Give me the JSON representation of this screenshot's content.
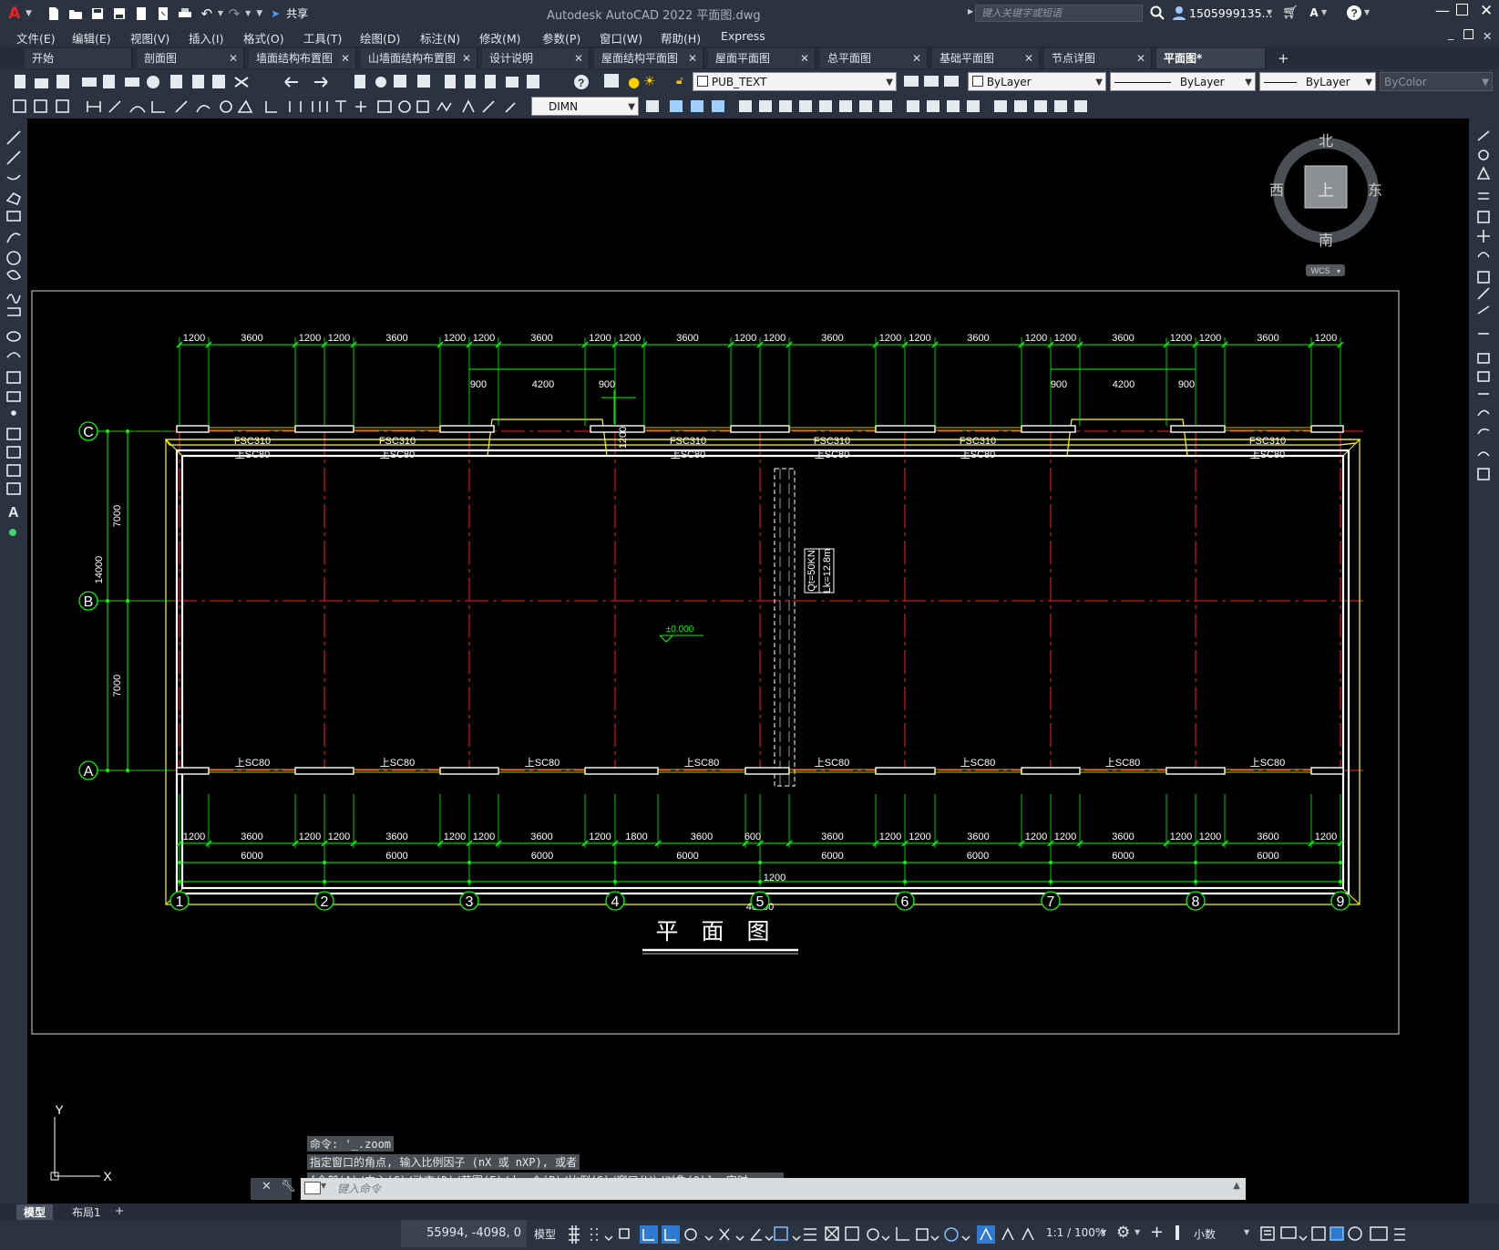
{
  "app": {
    "title": "Autodesk AutoCAD 2022    平面图.dwg",
    "share_label": "共享",
    "search_placeholder": "键入关键字或短语",
    "user": "1505999135...",
    "logo_letter": "A"
  },
  "menu": [
    "文件(E)",
    "编辑(E)",
    "视图(V)",
    "插入(I)",
    "格式(O)",
    "工具(T)",
    "绘图(D)",
    "标注(N)",
    "修改(M)",
    "参数(P)",
    "窗口(W)",
    "帮助(H)",
    "Express"
  ],
  "tabs": [
    {
      "label": "开始",
      "closable": false
    },
    {
      "label": "剖面图",
      "closable": true
    },
    {
      "label": "墙面结构布置图",
      "closable": true
    },
    {
      "label": "山墙面结构布置图",
      "closable": true
    },
    {
      "label": "设计说明",
      "closable": true
    },
    {
      "label": "屋面结构平面图",
      "closable": true
    },
    {
      "label": "屋面平面图",
      "closable": true
    },
    {
      "label": "总平面图",
      "closable": true
    },
    {
      "label": "基础平面图",
      "closable": true
    },
    {
      "label": "节点详图",
      "closable": true
    },
    {
      "label": "平面图*",
      "closable": false,
      "active": true
    }
  ],
  "properties": {
    "layer": "PUB_TEXT",
    "color": "ByLayer",
    "linetype": "ByLayer",
    "lineweight": "ByLayer",
    "plotstyle": "ByColor",
    "dimstyle": "DIMN"
  },
  "viewcube": {
    "north": "北",
    "south": "南",
    "east": "东",
    "west": "西",
    "top": "上",
    "wcs": "WCS"
  },
  "ucs": {
    "x": "X",
    "y": "Y"
  },
  "drawing": {
    "title": "平　面　图",
    "elevation": "±0.000",
    "crane_q": "Qt=50KN",
    "crane_l": "Lk=12.8m",
    "row_axes": [
      "C",
      "B",
      "A"
    ],
    "col_axes": [
      "1",
      "2",
      "3",
      "4",
      "5",
      "6",
      "7",
      "8",
      "9"
    ],
    "top_dims": [
      "1200",
      "3600",
      "1200",
      "1200",
      "3600",
      "1200",
      "1200",
      "3600",
      "1200",
      "1200",
      "3600",
      "1200",
      "1200",
      "3600",
      "1200",
      "1200",
      "3600",
      "1200",
      "1200",
      "3600",
      "1200",
      "1200",
      "3600",
      "1200"
    ],
    "door_dims": [
      "900",
      "4200",
      "900"
    ],
    "door_depth": "1200",
    "bottom_dims": [
      "1200",
      "3600",
      "1200",
      "1200",
      "3600",
      "1200",
      "1200",
      "3600",
      "1200",
      "1800",
      "3600",
      "600",
      "3600",
      "1200",
      "1200",
      "3600",
      "1200",
      "1200",
      "3600",
      "1200",
      "1200",
      "3600",
      "1200"
    ],
    "bottom_extra": "1200",
    "bay_dims": [
      "6000",
      "6000",
      "6000",
      "6000",
      "6000",
      "6000",
      "6000",
      "6000"
    ],
    "total_dim": "48000",
    "left_dims": [
      "7000",
      "7000"
    ],
    "left_total": "14000",
    "top_windows": [
      "FSC310",
      "FSC310",
      "FSC310",
      "FSC310",
      "FSC310",
      "FSC310"
    ],
    "top_windows_sub": [
      "上SC80",
      "上SC80",
      "上SC80",
      "上SC80",
      "上SC80",
      "上SC80"
    ],
    "bottom_windows": [
      "上SC80",
      "上SC80",
      "上SC80",
      "上SC80",
      "上SC80",
      "上SC80",
      "上SC80",
      "上SC80"
    ]
  },
  "command": {
    "history": [
      "命令: '_.zoom",
      "指定窗口的角点, 输入比例因子 (nX 或 nXP), 或者",
      "[全部(A)/中心(C)/动态(D)/范围(E)/上一个(P)/比例(S)/窗口(W)/对象(O)] <实时>: _e"
    ],
    "placeholder": "键入命令"
  },
  "layout_tabs": [
    "模型",
    "布局1",
    "+"
  ],
  "status": {
    "coords": "55994, -4098, 0",
    "model": "模型",
    "scale": "1:1 / 100%",
    "units": "小数"
  },
  "colors": {
    "grid_axis": "#ff2020",
    "dims": "#00ff00",
    "wall": "#ffffff",
    "outline": "#ffff00",
    "background": "#000000"
  }
}
